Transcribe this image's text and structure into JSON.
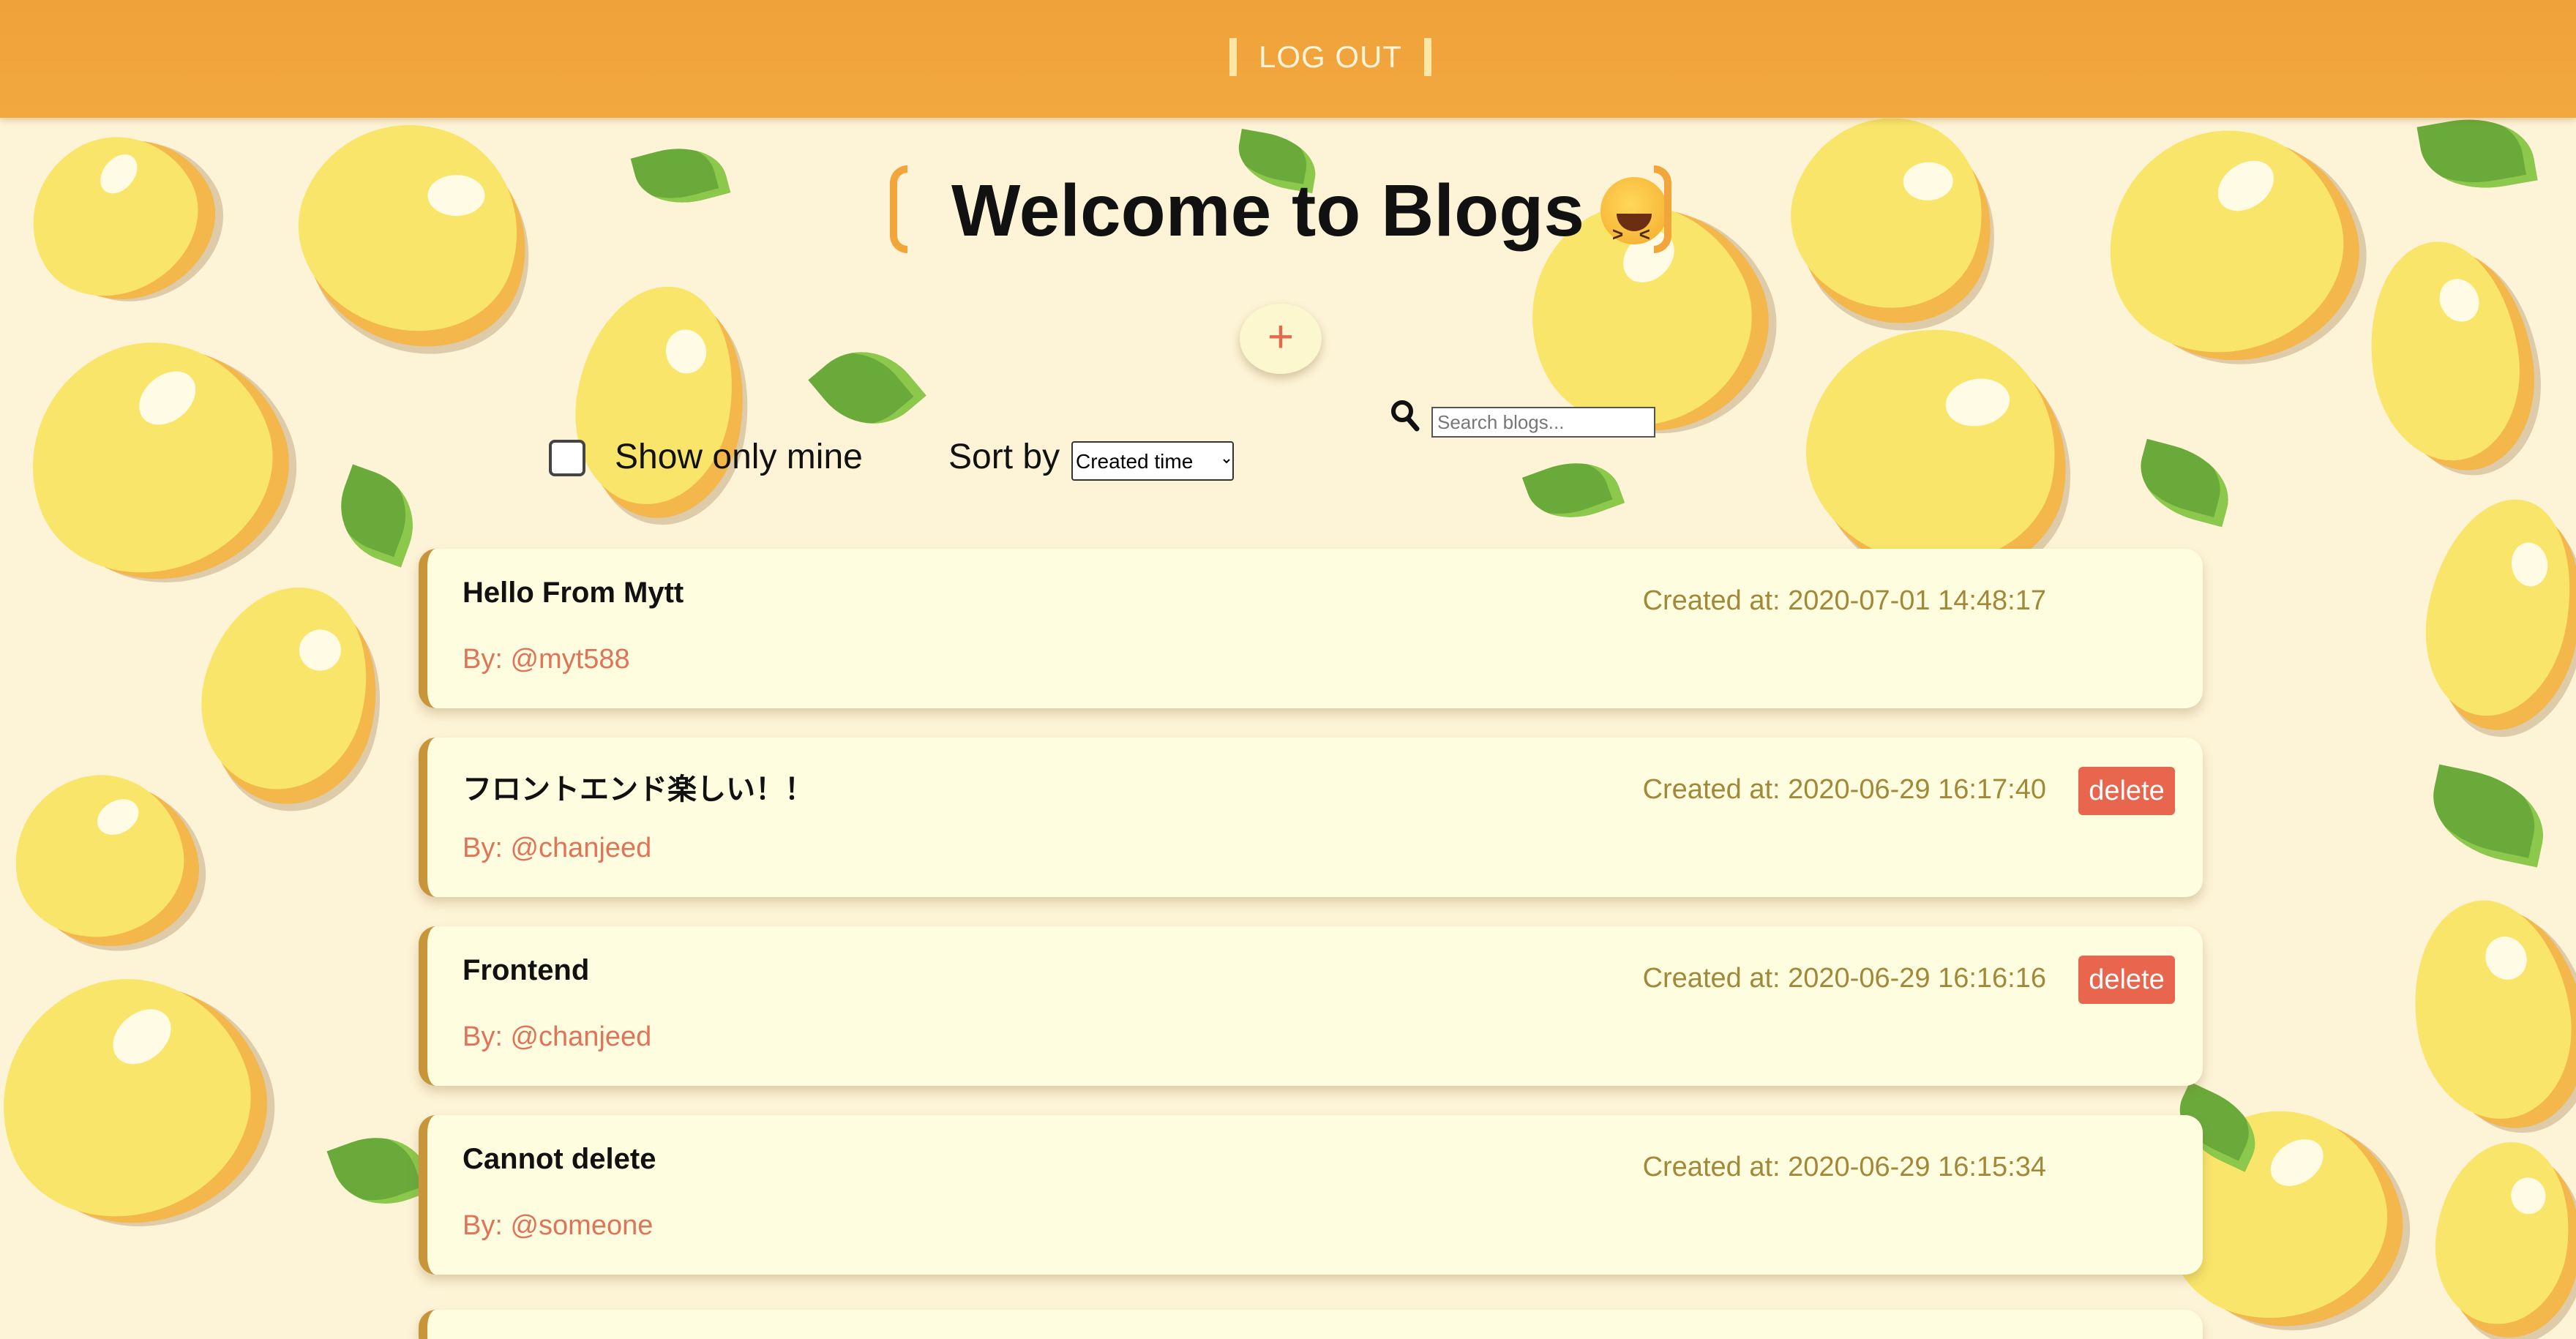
{
  "header": {
    "logout_label": "LOG OUT"
  },
  "page": {
    "title": "Welcome to Blogs",
    "add_label": "+"
  },
  "filters": {
    "show_only_mine_label": "Show only mine",
    "show_only_mine_checked": false,
    "sort_label": "Sort by",
    "sort_selected": "Created time",
    "search_placeholder": "Search blogs..."
  },
  "blogs": [
    {
      "title": "Hello From Mytt",
      "author": "By: @myt588",
      "created": "Created at: 2020-07-01 14:48:17",
      "delete_label": ""
    },
    {
      "title": "フロントエンド楽しい！！",
      "author": "By: @chanjeed",
      "created": "Created at: 2020-06-29 16:17:40",
      "delete_label": "delete"
    },
    {
      "title": "Frontend",
      "author": "By: @chanjeed",
      "created": "Created at: 2020-06-29 16:16:16",
      "delete_label": "delete"
    },
    {
      "title": "Cannot delete",
      "author": "By: @someone",
      "created": "Created at: 2020-06-29 16:15:34",
      "delete_label": ""
    }
  ],
  "colors": {
    "header": "#f0a13a",
    "card_bg": "#fffde0",
    "card_accent": "#c7963a",
    "author": "#e07459",
    "date": "#a2893a",
    "delete": "#e8654e"
  },
  "icons": {
    "emoji": "laughing-face-icon",
    "search": "search-icon"
  }
}
